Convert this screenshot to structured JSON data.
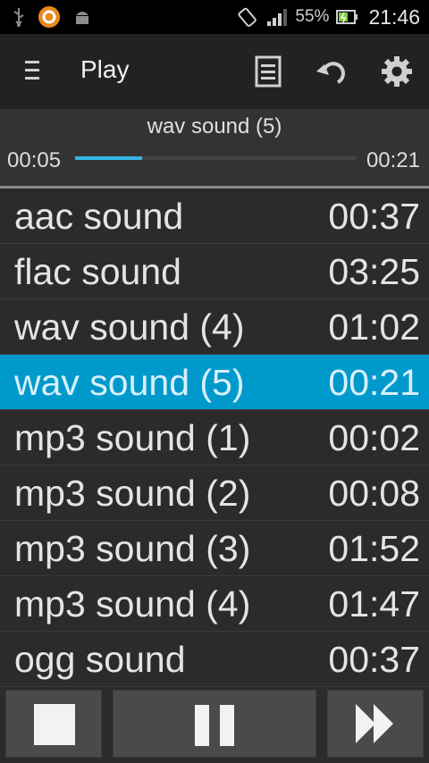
{
  "status_bar": {
    "battery_percent": "55%",
    "time": "21:46",
    "left_icons": [
      "usb-icon",
      "app-notification-icon",
      "android-debug-icon"
    ],
    "right_icons": [
      "rotate-icon",
      "signal-icon",
      "battery-icon"
    ]
  },
  "action_bar": {
    "title": "Play",
    "icons": [
      "menu-icon",
      "playlist-icon",
      "undo-icon",
      "settings-icon"
    ]
  },
  "now_playing": {
    "title": "wav sound (5)",
    "elapsed": "00:05",
    "duration": "00:21",
    "progress_fraction": 0.24
  },
  "tracks": [
    {
      "name": "aac sound",
      "duration": "00:37"
    },
    {
      "name": "flac sound",
      "duration": "03:25"
    },
    {
      "name": "wav sound (4)",
      "duration": "01:02"
    },
    {
      "name": "wav sound (5)",
      "duration": "00:21"
    },
    {
      "name": "mp3 sound (1)",
      "duration": "00:02"
    },
    {
      "name": "mp3 sound (2)",
      "duration": "00:08"
    },
    {
      "name": "mp3 sound (3)",
      "duration": "01:52"
    },
    {
      "name": "mp3 sound (4)",
      "duration": "01:47"
    },
    {
      "name": "ogg sound",
      "duration": "00:37"
    }
  ],
  "selected_index": 3,
  "controls": [
    "stop-button",
    "pause-button",
    "next-button"
  ],
  "colors": {
    "accent": "#33b5e5",
    "selected_row": "#0099cc",
    "background": "#2b2b2b"
  }
}
